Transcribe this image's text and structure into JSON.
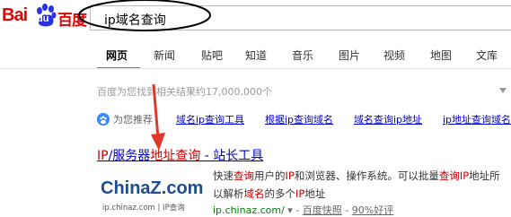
{
  "logo": {
    "bai": "Bai",
    "du": "du",
    "cn": "百度"
  },
  "search": {
    "query": "ip域名查询"
  },
  "tabs": [
    "网页",
    "新闻",
    "贴吧",
    "知道",
    "音乐",
    "图片",
    "视频",
    "地图",
    "文库"
  ],
  "result_count": "百度为您找到相关结果约17,000,000个",
  "recommend": {
    "label": "为您推荐",
    "links": [
      "域名ip查询工具",
      "根据ip查询域名",
      "域名查询ip地址",
      "ip地址查询域名"
    ]
  },
  "result": {
    "title_parts": [
      "IP",
      "/服务器",
      "地址查询",
      " - 站长工具"
    ],
    "desc_line1_parts": [
      "快速",
      "查询",
      "用户的",
      "IP",
      "和浏览器、操作系统。可以批量",
      "查询",
      "IP",
      "地址所"
    ],
    "desc_line2_parts": [
      "以解析",
      "域名",
      "的多个",
      "IP",
      "地址"
    ],
    "url": "ip.chinaz.com/",
    "snapshot": "百度快照",
    "rating": "90%好评",
    "thumb_brand": "ChinaZ.com",
    "thumb_sub": "ip.chinaz.com | IP查询"
  },
  "colors": {
    "brand_red": "#e10602",
    "brand_blue": "#2932e1",
    "link": "#0000cc",
    "highlight": "#cc0000",
    "url_green": "#008000",
    "annotation": "#e0392b"
  },
  "icons": [
    "baidu-paw-icon",
    "recommend-icon",
    "filter-arrow-icon",
    "dropdown-arrow-icon",
    "annotation-arrow-icon"
  ]
}
